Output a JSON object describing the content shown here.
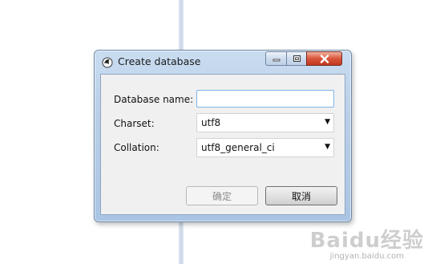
{
  "window": {
    "title": "Create database",
    "icon": "dolphin-app-icon",
    "controls": [
      "minimize-icon",
      "maximize-icon",
      "close-icon"
    ]
  },
  "form": {
    "database_name": {
      "label": "Database name:",
      "value": ""
    },
    "charset": {
      "label": "Charset:",
      "value": "utf8"
    },
    "collation": {
      "label": "Collation:",
      "value": "utf8_general_ci"
    }
  },
  "buttons": {
    "ok": "确定",
    "cancel": "取消"
  },
  "watermark": {
    "main": "Baidu经验",
    "sub": "jingyan.baidu.com"
  },
  "colors": {
    "titlebar": "#b9cfe8",
    "close_button": "#d9553b",
    "input_focus_border": "#7eb4ea",
    "dialog_body": "#f0f0f0"
  }
}
